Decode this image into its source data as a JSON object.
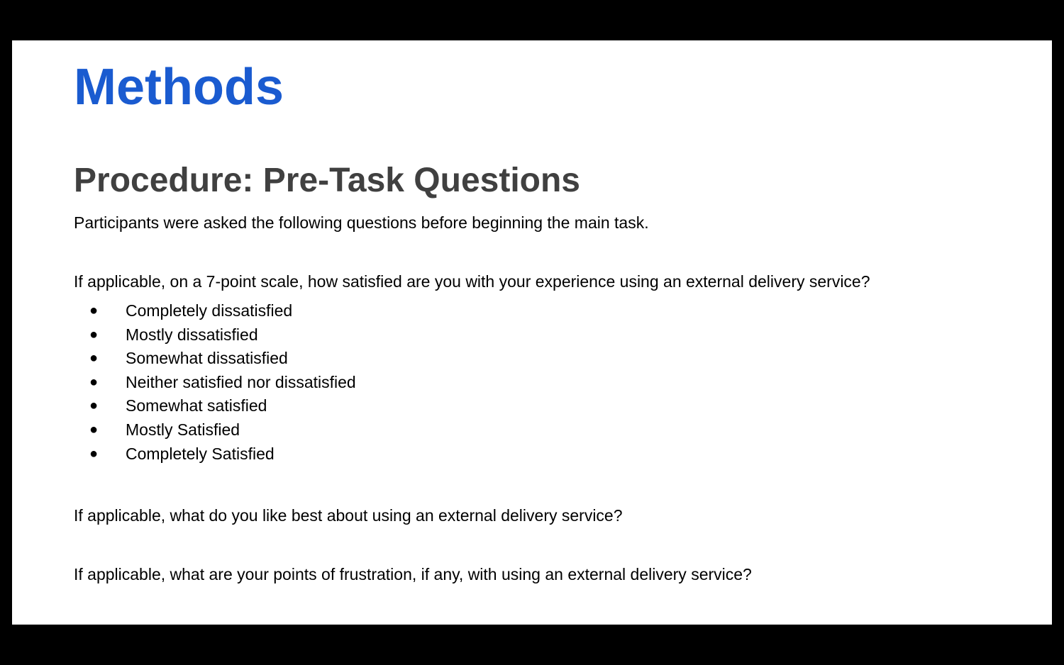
{
  "slide": {
    "title": "Methods",
    "subtitle": "Procedure: Pre-Task Questions",
    "intro": "Participants were asked the following questions before beginning the main task.",
    "question1": "If applicable, on a 7-point scale, how satisfied are you with your experience using an external delivery service?",
    "bullet_glyph": "●",
    "options": [
      "Completely dissatisfied",
      "Mostly dissatisfied",
      "Somewhat dissatisfied",
      "Neither satisfied nor dissatisfied",
      "Somewhat satisfied",
      "Mostly Satisfied",
      "Completely Satisfied"
    ],
    "question2": "If applicable, what do you like best about using an external delivery service?",
    "question3": "If applicable, what are your points of frustration, if any, with using an external delivery service?"
  },
  "colors": {
    "title": "#1a5bd0",
    "subtitle": "#404040",
    "background": "#ffffff",
    "frame": "#000000"
  }
}
